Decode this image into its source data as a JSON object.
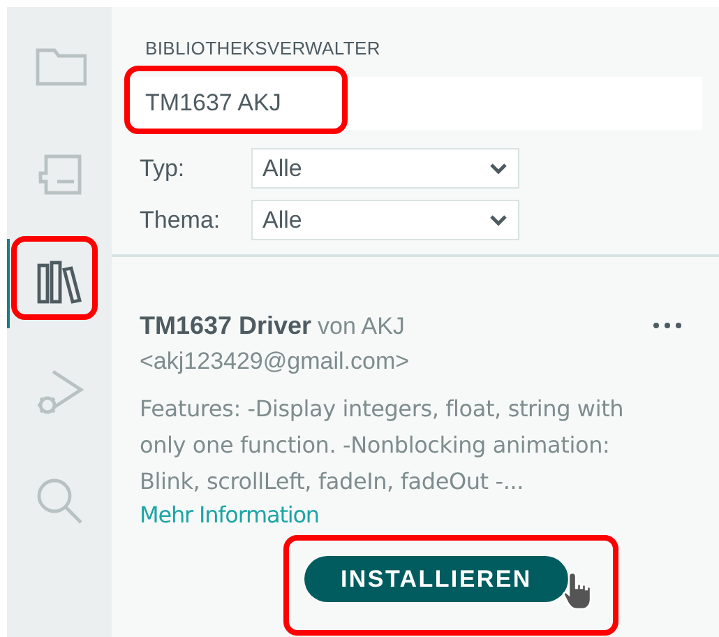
{
  "sidebar": {
    "items": [
      {
        "kind": "folder",
        "selected": false,
        "highlighted": false
      },
      {
        "kind": "board",
        "selected": false,
        "highlighted": false
      },
      {
        "kind": "library",
        "selected": true,
        "highlighted": true
      },
      {
        "kind": "debug",
        "selected": false,
        "highlighted": false
      },
      {
        "kind": "search",
        "selected": false,
        "highlighted": false
      }
    ]
  },
  "panel": {
    "title": "BIBLIOTHEKSVERWALTER",
    "search": {
      "value": "TM1637 AKJ",
      "highlighted": true
    },
    "filters": [
      {
        "label": "Typ:",
        "value": "Alle"
      },
      {
        "label": "Thema:",
        "value": "Alle"
      }
    ],
    "library": {
      "name": "TM1637 Driver",
      "by": "von AKJ",
      "email": "<akj123429@gmail.com>",
      "description": "Features: -Display integers, float, string with only one function. -Nonblocking animation: Blink, scrollLeft, fadeIn, fadeOut -...",
      "link": "Mehr Information",
      "button": {
        "label": "INSTALLIEREN",
        "highlighted": true,
        "hovered": true
      }
    }
  }
}
